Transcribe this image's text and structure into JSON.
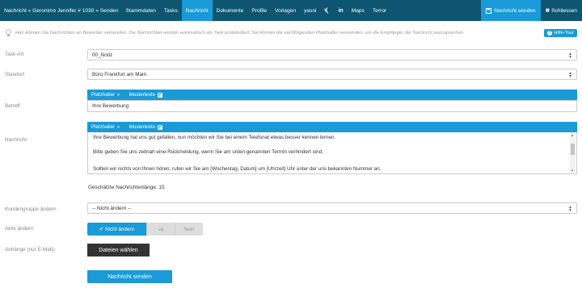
{
  "topbar": {
    "breadcrumb": "Nachricht » Geronimo Jennifer # 1030 » Senden",
    "nav": [
      "Stammdaten",
      "Tasks",
      "Nachricht",
      "Dokumente",
      "Profile",
      "Vorlagen",
      "yasni"
    ],
    "nav_maps": "Maps",
    "nav_terror": "Terror",
    "send_label": "Nachricht senden",
    "close_label": "Schliessen"
  },
  "info": {
    "text": "Hier können Sie Nachrichten an Bewerber versenden. Die Nachrichten werden automatisch als Task protokolliert. Sie können die nachfolgenden Platzhalter verwenden, um die Empfänger der Nachricht anzusprechen.",
    "tour_label": "Hilfe-Tour"
  },
  "form": {
    "task_art": {
      "label": "Task-Art",
      "value": "00_Notiz"
    },
    "standort": {
      "label": "Standort",
      "value": "Büro Frankfurt am Main"
    },
    "betreff": {
      "label": "Betreff",
      "value": "Ihre Bewerbung"
    },
    "nachricht": {
      "label": "Nachricht",
      "lines": [
        "Ihre Bewerbung hat uns gut gefallen, nun möchten wir Sie bei einem Telefonat etwas besser kennen lernen.",
        "Bitte geben Sie uns zeitnah eine Rückmeldung, wenn Sie am unten genannten Termin verhindert sind.",
        "Sollten wir nichts von Ihnen hören, rufen wir Sie am [Wochentag, Datum] um [Uhrzeit] Uhr unter der uns bekannten Nummer an."
      ]
    },
    "toolbar": {
      "placeholder_label": "Platzhalter",
      "templates_label": "Mustertexte"
    },
    "length_note": "Geschätzte Nachrichtenlänge: 15",
    "kundengruppe": {
      "label": "Kundengruppe ändern",
      "value": "-- Nicht ändern --"
    },
    "aktiv": {
      "label": "Aktiv ändern",
      "options": [
        "Nicht ändern",
        "Ja",
        "Nein"
      ],
      "selected": "Nicht ändern"
    },
    "anhaenge": {
      "label": "Anhänge (nur E-Mail):",
      "button": "Dateien wählen"
    },
    "submit": "Nachricht senden"
  }
}
